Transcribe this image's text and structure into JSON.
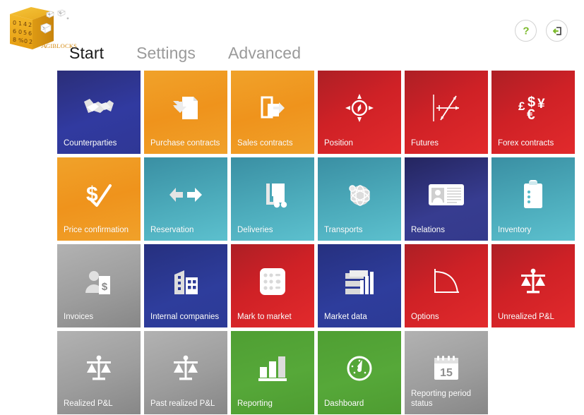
{
  "app": {
    "logo_text": "AGIBLOCKS",
    "logo_name": "agiblocks-logo"
  },
  "header": {
    "tabs": [
      {
        "label": "Start",
        "active": true,
        "name": "tab-start"
      },
      {
        "label": "Settings",
        "active": false,
        "name": "tab-settings"
      },
      {
        "label": "Advanced",
        "active": false,
        "name": "tab-advanced"
      }
    ],
    "icons": [
      {
        "name": "help-icon",
        "glyph": "question-mark"
      },
      {
        "name": "logout-icon",
        "glyph": "exit-arrow"
      }
    ]
  },
  "colors": {
    "navy": "#2f3795",
    "indigo": "#343a8c",
    "blue": "#2c3a96",
    "orange": "#ef931c",
    "red": "#cf2126",
    "teal": "#4cabbb",
    "gray": "#9d9d9d",
    "green": "#56a839",
    "accent_green": "#7ab929",
    "tab_active": "#1a1a1a",
    "tab_inactive": "#9a9a9a"
  },
  "tiles": [
    {
      "label": "Counterparties",
      "theme": "t-navy",
      "icon": "handshake-icon"
    },
    {
      "label": "Purchase contracts",
      "theme": "t-orange",
      "icon": "document-import-icon"
    },
    {
      "label": "Sales contracts",
      "theme": "t-orange",
      "icon": "document-export-icon"
    },
    {
      "label": "Position",
      "theme": "t-red",
      "icon": "compass-icon"
    },
    {
      "label": "Futures",
      "theme": "t-red",
      "icon": "line-chart-icon"
    },
    {
      "label": "Forex contracts",
      "theme": "t-red",
      "icon": "currency-symbols-icon"
    },
    {
      "label": "Price confirmation",
      "theme": "t-orange",
      "icon": "dollar-check-icon"
    },
    {
      "label": "Reservation",
      "theme": "t-teal",
      "icon": "left-right-arrows-icon"
    },
    {
      "label": "Deliveries",
      "theme": "t-teal",
      "icon": "forklift-icon"
    },
    {
      "label": "Transports",
      "theme": "t-teal",
      "icon": "globe-icon"
    },
    {
      "label": "Relations",
      "theme": "t-indigo",
      "icon": "id-card-icon"
    },
    {
      "label": "Inventory",
      "theme": "t-teal",
      "icon": "clipboard-icon"
    },
    {
      "label": "Invoices",
      "theme": "t-gray",
      "icon": "person-invoice-icon"
    },
    {
      "label": "Internal companies",
      "theme": "t-blue",
      "icon": "buildings-icon"
    },
    {
      "label": "Mark to market",
      "theme": "t-red",
      "icon": "calculator-icon"
    },
    {
      "label": "Market data",
      "theme": "t-blue",
      "icon": "bar-chart-stack-icon"
    },
    {
      "label": "Options",
      "theme": "t-red",
      "icon": "curve-graph-icon"
    },
    {
      "label": "Unrealized P&L",
      "theme": "t-red",
      "icon": "scales-icon"
    },
    {
      "label": "Realized P&L",
      "theme": "t-gray",
      "icon": "scales-icon"
    },
    {
      "label": "Past realized P&L",
      "theme": "t-gray",
      "icon": "scales-icon"
    },
    {
      "label": "Reporting",
      "theme": "t-green",
      "icon": "bar-chart-icon"
    },
    {
      "label": "Dashboard",
      "theme": "t-green",
      "icon": "gauge-icon"
    },
    {
      "label": "Reporting period status",
      "theme": "t-gray",
      "icon": "calendar-15-icon"
    }
  ]
}
